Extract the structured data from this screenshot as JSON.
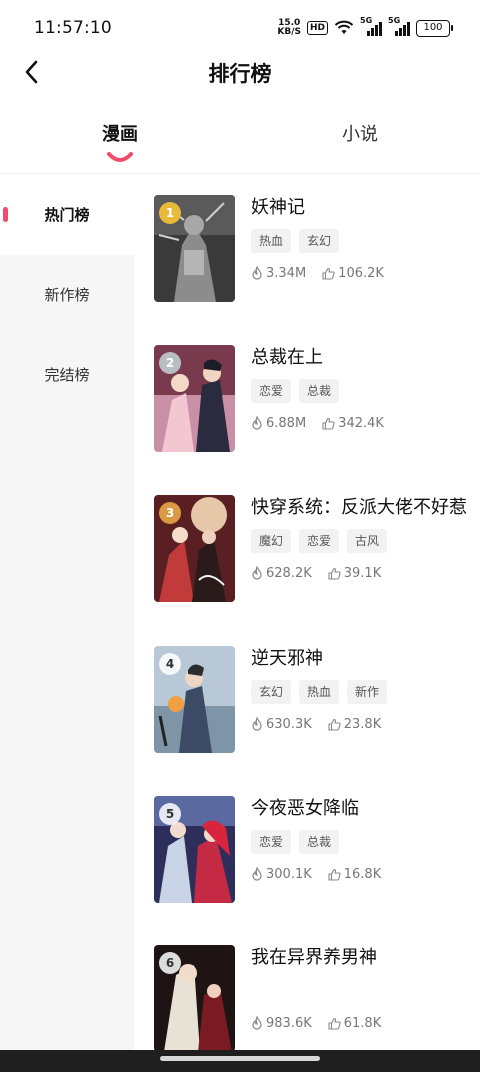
{
  "status_bar": {
    "time": "11:57:10",
    "net_speed_value": "15.0",
    "net_speed_unit": "KB/S",
    "hd_badge": "HD",
    "sig1_label": "5G",
    "sig2_label": "5G",
    "battery": "100"
  },
  "header": {
    "title": "排行榜",
    "back_icon": "chevron-left-icon"
  },
  "tabs": [
    {
      "label": "漫画",
      "active": true
    },
    {
      "label": "小说",
      "active": false
    }
  ],
  "sidebar": {
    "items": [
      {
        "label": "热门榜",
        "active": true
      },
      {
        "label": "新作榜",
        "active": false
      },
      {
        "label": "完结榜",
        "active": false
      }
    ]
  },
  "colors": {
    "accent": "#f24b6a",
    "gold": "#e8b93a",
    "silver": "#b9bcc2",
    "bronze": "#d99a42"
  },
  "list": [
    {
      "rank": "1",
      "name": "妖神记",
      "tags": [
        "热血",
        "玄幻"
      ],
      "heat": "3.34M",
      "likes": "106.2K"
    },
    {
      "rank": "2",
      "name": "总裁在上",
      "tags": [
        "恋爱",
        "总裁"
      ],
      "heat": "6.88M",
      "likes": "342.4K"
    },
    {
      "rank": "3",
      "name": "快穿系统：反派大佬不好惹",
      "tags": [
        "魔幻",
        "恋爱",
        "古风"
      ],
      "heat": "628.2K",
      "likes": "39.1K"
    },
    {
      "rank": "4",
      "name": "逆天邪神",
      "tags": [
        "玄幻",
        "热血",
        "新作"
      ],
      "heat": "630.3K",
      "likes": "23.8K"
    },
    {
      "rank": "5",
      "name": "今夜恶女降临",
      "tags": [
        "恋爱",
        "总裁"
      ],
      "heat": "300.1K",
      "likes": "16.8K"
    },
    {
      "rank": "6",
      "name": "我在异界养男神",
      "tags": [],
      "heat": "983.6K",
      "likes": "61.8K"
    }
  ]
}
